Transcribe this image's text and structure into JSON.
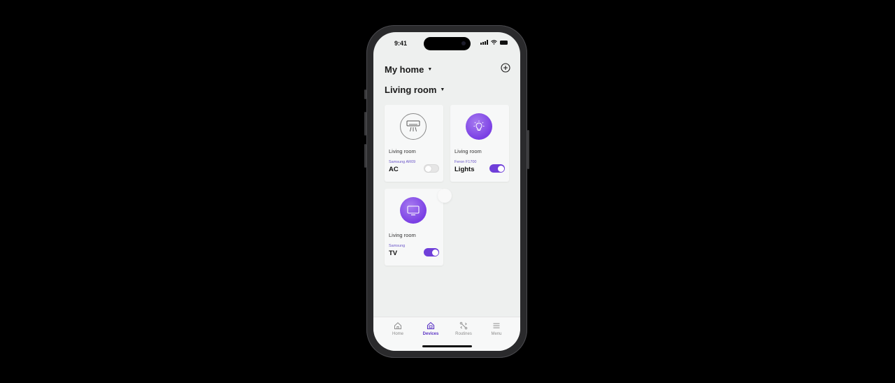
{
  "status_bar": {
    "time": "9:41"
  },
  "header": {
    "home_label": "My home",
    "room_label": "Living room"
  },
  "devices": [
    {
      "room": "Living room",
      "model": "Samsung AR09",
      "name": "AC",
      "icon": "air-conditioner-icon",
      "on": false
    },
    {
      "room": "Living room",
      "model": "Feron F1700",
      "name": "Lights",
      "icon": "lightbulb-icon",
      "on": true
    },
    {
      "room": "Living room",
      "model": "Samsung",
      "name": "TV",
      "icon": "tv-icon",
      "on": true
    }
  ],
  "tabbar": {
    "tabs": [
      {
        "label": "Home",
        "icon": "home-icon",
        "active": false
      },
      {
        "label": "Devices",
        "icon": "devices-house-icon",
        "active": true
      },
      {
        "label": "Routines",
        "icon": "routines-icon",
        "active": false
      },
      {
        "label": "Menu",
        "icon": "menu-icon",
        "active": false
      }
    ]
  },
  "colors": {
    "accent": "#6f3fd9",
    "icon_gradient_light": "#a77bf0",
    "icon_gradient_dark": "#7a3fe4",
    "background": "#000000",
    "screen": "#eef0ef"
  }
}
